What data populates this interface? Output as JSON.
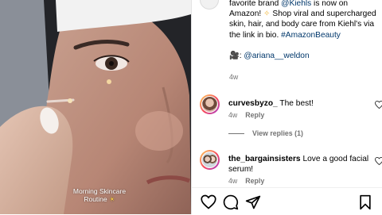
{
  "video": {
    "overlay_line1": "Morning Skincare",
    "overlay_line2": "Routine"
  },
  "caption": {
    "part1": "favorite brand ",
    "mention": "@Kiehls",
    "part2": " is now on Amazon! ",
    "part3": " Shop viral and supercharged skin, hair, and body care from Kiehl's via the link in bio. ",
    "hashtag": "#AmazonBeauty",
    "credit_mention": "@ariana__weldon",
    "time": "4w"
  },
  "comments": [
    {
      "username": "curvesbyzo_",
      "text": "The best!",
      "time": "4w",
      "reply_label": "Reply"
    },
    {
      "username": "the_bargainsisters",
      "text": "Love a good facial serum!",
      "time": "4w",
      "reply_label": "Reply"
    }
  ],
  "view_replies": "View replies (1)",
  "icons": [
    "heart-icon",
    "comment-icon",
    "share-icon",
    "bookmark-icon"
  ]
}
